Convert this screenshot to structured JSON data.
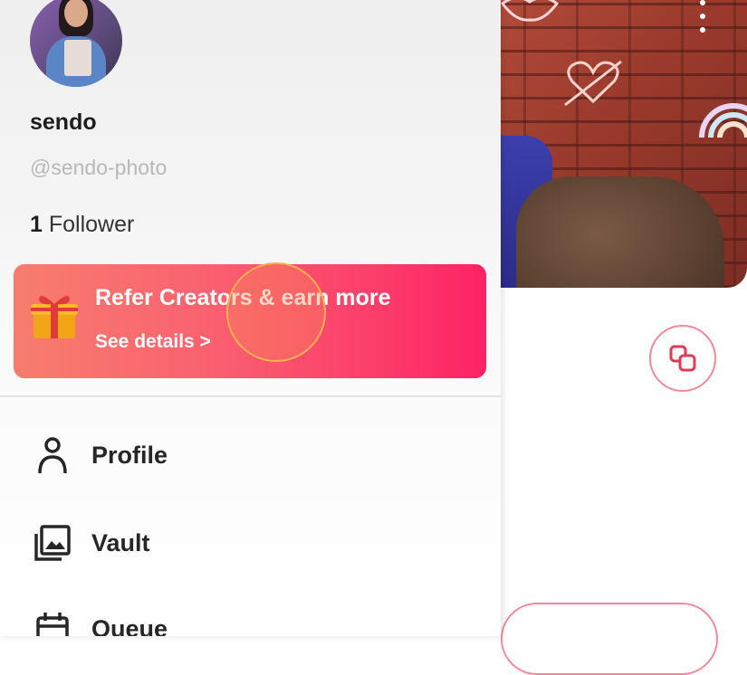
{
  "profile": {
    "name": "sendo",
    "handle": "@sendo-photo",
    "follower_count": "1",
    "follower_label": "Follower"
  },
  "promo": {
    "title": "Refer Creators & earn more",
    "link": "See details >",
    "gradient_start": "#f77d6e",
    "gradient_end": "#fe2264",
    "icon": "gift-icon"
  },
  "menu": {
    "items": [
      {
        "label": "Profile",
        "icon": "person-icon"
      },
      {
        "label": "Vault",
        "icon": "gallery-icon"
      },
      {
        "label": "Queue",
        "icon": "calendar-icon"
      }
    ]
  },
  "colors": {
    "accent": "#f08a9a",
    "tap_ring": "#f3b24c"
  }
}
